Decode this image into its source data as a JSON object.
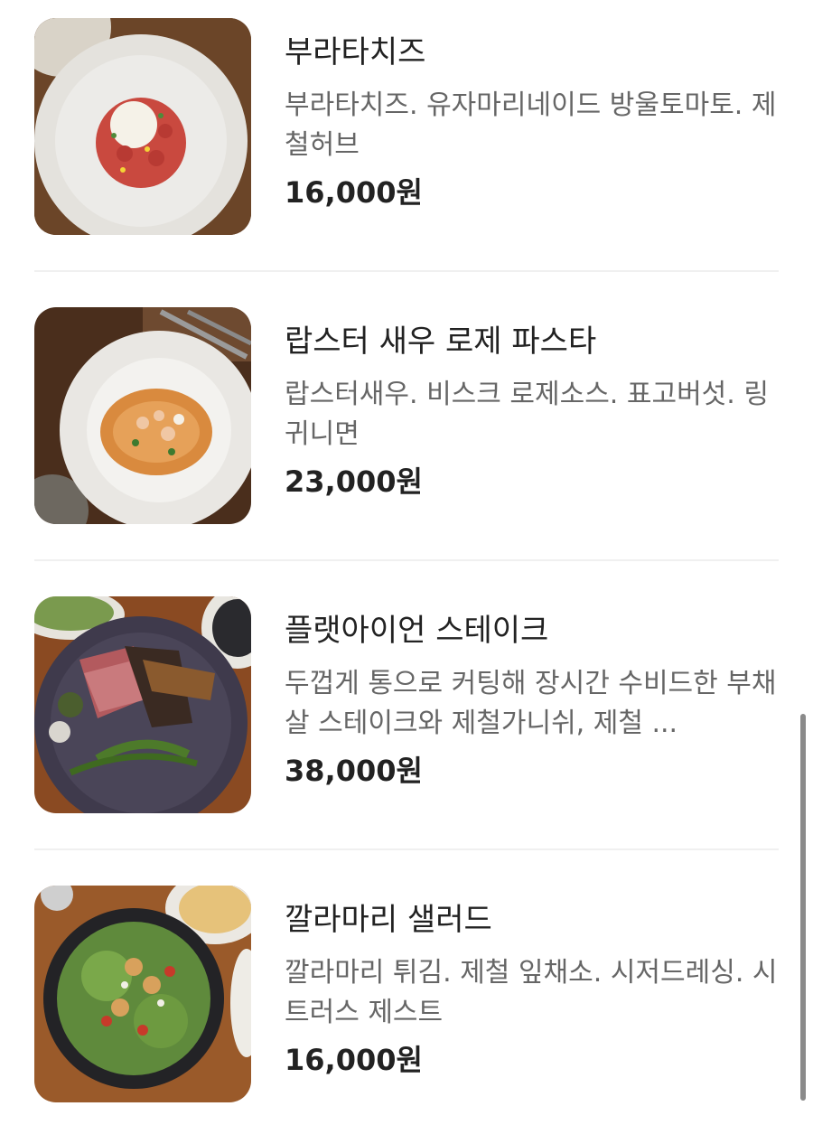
{
  "menu": {
    "items": [
      {
        "name": "부라타치즈",
        "description": "부라타치즈. 유자마리네이드 방울토마토. 제철허브",
        "price": "16,000원",
        "image_icon": "burrata-dish-photo"
      },
      {
        "name": "랍스터 새우 로제 파스타",
        "description": "랍스터새우. 비스크 로제소스. 표고버섯. 링귀니면",
        "price": "23,000원",
        "image_icon": "rose-pasta-photo"
      },
      {
        "name": "플랫아이언 스테이크",
        "description": "두껍게 통으로 커팅해 장시간 수비드한 부채살 스테이크와 제철가니쉬, 제철 ...",
        "price": "38,000원",
        "image_icon": "steak-dish-photo"
      },
      {
        "name": "깔라마리 샐러드",
        "description": "깔라마리 튀김. 제철 잎채소. 시저드레싱. 시트러스 제스트",
        "price": "16,000원",
        "image_icon": "calamari-salad-photo"
      }
    ]
  },
  "colors": {
    "title": "#222222",
    "description": "#666666",
    "divider": "#f0f0f0",
    "scrollbar": "#8a8a8a"
  }
}
